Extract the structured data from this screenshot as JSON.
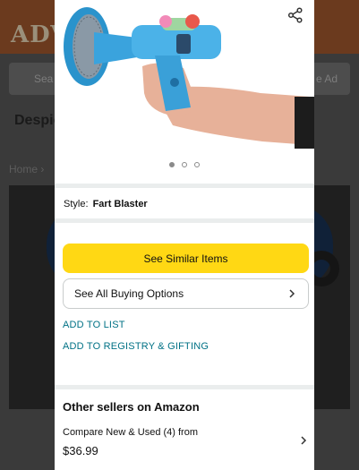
{
  "background_page": {
    "logo_text": "ADV",
    "nav_left_text": "Sea",
    "nav_right_text": "e Ad",
    "title_text": "Despic",
    "breadcrumb": "Home  ›"
  },
  "modal": {
    "product_image_alt": "blue toy blaster held in hand",
    "share_icon": "share-icon",
    "carousel": {
      "count": 3,
      "active_index": 0
    },
    "style_label": "Style:",
    "style_value": "Fart Blaster",
    "see_similar_label": "See Similar Items",
    "buying_options_label": "See All Buying Options",
    "add_to_list_label": "ADD TO LIST",
    "add_to_registry_label": "ADD TO REGISTRY & GIFTING",
    "other_sellers_title": "Other sellers on Amazon",
    "compare_label": "Compare New & Used (4) from",
    "price": "$36.99"
  },
  "colors": {
    "primary_button": "#ffd814",
    "link": "#007185",
    "separator": "#eaeded"
  }
}
